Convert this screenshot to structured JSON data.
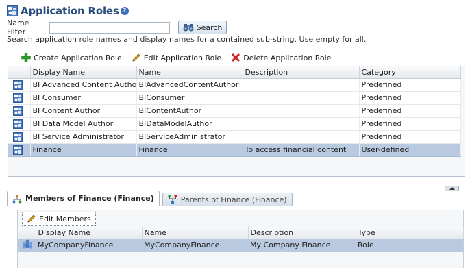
{
  "page": {
    "title": "Application Roles",
    "help_icon": "help-icon",
    "title_icon": "application-roles-icon"
  },
  "filter": {
    "label": "Name Filter",
    "value": "",
    "placeholder": "",
    "search_label": "Search",
    "search_icon": "binoculars-icon",
    "hint": "Search application role names and display names for a contained sub-string. Use empty for all."
  },
  "toolbar": {
    "create_label": "Create Application Role",
    "edit_label": "Edit Application Role",
    "delete_label": "Delete Application Role"
  },
  "roles_table": {
    "columns": [
      "Display Name",
      "Name",
      "Description",
      "Category"
    ],
    "rows": [
      {
        "display_name": "BI Advanced Content Author",
        "name": "BIAdvancedContentAuthor",
        "description": "",
        "category": "Predefined"
      },
      {
        "display_name": "BI Consumer",
        "name": "BIConsumer",
        "description": "",
        "category": "Predefined"
      },
      {
        "display_name": "BI Content Author",
        "name": "BIContentAuthor",
        "description": "",
        "category": "Predefined"
      },
      {
        "display_name": "BI Data Model Author",
        "name": "BIDataModelAuthor",
        "description": "",
        "category": "Predefined"
      },
      {
        "display_name": "BI Service Administrator",
        "name": "BIServiceAdministrator",
        "description": "",
        "category": "Predefined"
      },
      {
        "display_name": "Finance",
        "name": "Finance",
        "description": "To access financial content",
        "category": "User-defined"
      }
    ],
    "selected_row": 5
  },
  "tabs": [
    {
      "label": "Members of Finance (Finance)",
      "active": true
    },
    {
      "label": "Parents of Finance (Finance)",
      "active": false
    }
  ],
  "members": {
    "edit_label": "Edit Members",
    "columns": [
      "Display Name",
      "Name",
      "Description",
      "Type"
    ],
    "rows": [
      {
        "display_name": "MyCompanyFinance",
        "name": "MyCompanyFinance",
        "description": "My Company Finance",
        "type": "Role"
      }
    ]
  },
  "colors": {
    "title": "#2a4f7e",
    "selection": "#b9c9e0",
    "add_green": "#2e9e2e",
    "delete_red": "#d02020"
  }
}
